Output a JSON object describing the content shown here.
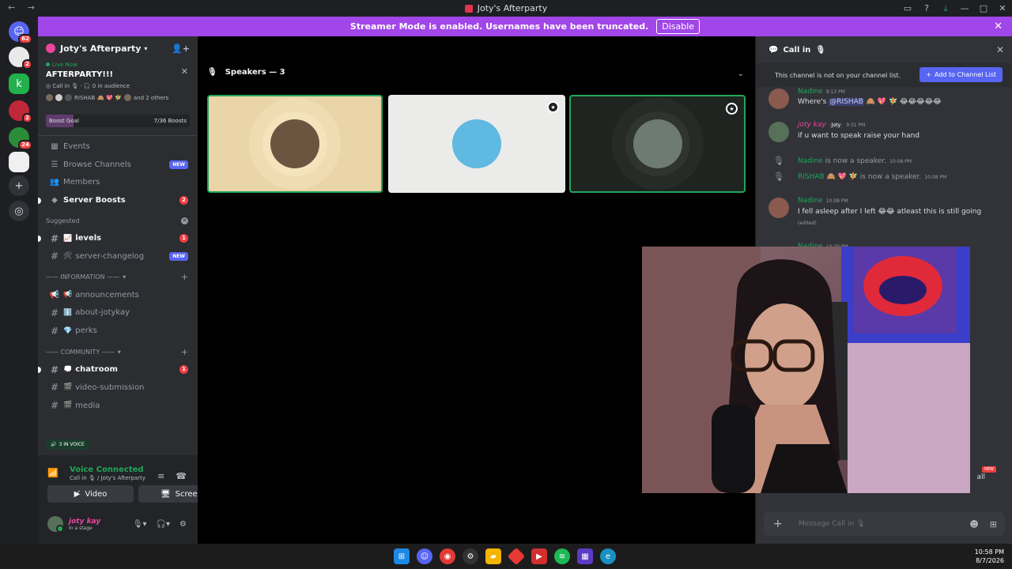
{
  "window": {
    "title": "Joty's Afterparty"
  },
  "guilds": [
    {
      "icon": "discord-home-icon",
      "badge": "62",
      "color": "#5865f2"
    },
    {
      "icon": "server-icon",
      "badge": "2",
      "color": "#e9e9e9"
    },
    {
      "icon": "server-icon",
      "badge": "",
      "color": "#22b14c"
    },
    {
      "icon": "server-icon",
      "badge": "2",
      "color": "#c0283a"
    },
    {
      "icon": "server-icon",
      "badge": "24",
      "color": "#2b8c3a"
    },
    {
      "icon": "server-icon",
      "badge": "",
      "color": "#f0f0f0"
    }
  ],
  "banner": {
    "text": "Streamer Mode is enabled. Usernames have been truncated.",
    "disable_label": "Disable"
  },
  "server": {
    "name": "Joty's Afterparty"
  },
  "live": {
    "status": "Live Now",
    "title": "AFTERPARTY!!!",
    "channel": "Call in",
    "audience": "0 in audience",
    "speaker_name": "RISHAB",
    "others": "and 2 others"
  },
  "boost": {
    "label": "Boost Goal",
    "count": "7/36 Boosts",
    "progress": 0.19
  },
  "nav": {
    "events": "Events",
    "browse": "Browse Channels",
    "browse_badge": "NEW",
    "members": "Members",
    "boosts": "Server Boosts",
    "boosts_badge": "2"
  },
  "suggested": {
    "label": "Suggested",
    "levels": {
      "emoji": "📈",
      "name": "levels",
      "badge": "1"
    },
    "changelog": {
      "emoji": "🛠",
      "name": "server-changelog",
      "badge": "NEW"
    }
  },
  "categories": {
    "information": "—— INFORMATION ——",
    "community": "—— COMMUNITY ——"
  },
  "channels": {
    "announcements": {
      "emoji": "📢",
      "name": "announcements"
    },
    "about": {
      "emoji": "ℹ️",
      "name": "about-jotykay"
    },
    "perks": {
      "emoji": "💎",
      "name": "perks"
    },
    "chatroom": {
      "emoji": "💭",
      "name": "chatroom",
      "badge": "1"
    },
    "video": {
      "emoji": "🎬",
      "name": "video-submission"
    },
    "media": {
      "emoji": "🎬",
      "name": "media"
    }
  },
  "in_voice": "3 IN VOICE",
  "voice": {
    "status": "Voice Connected",
    "location": "Call in 🎙 / Joty's Afterparty",
    "video_label": "Video",
    "screen_label": "Screen"
  },
  "user": {
    "name": "joty kay",
    "status": "In a stage"
  },
  "stage": {
    "speakers_label": "Speakers — 3",
    "tiles": [
      {
        "bg": "#ead5a8",
        "ring1": "#f0dcb2",
        "ring2": "#f5e3bc",
        "pic": "#6b5440",
        "border": "#23a55a",
        "mod": false
      },
      {
        "bg": "#ebebea",
        "ring1": "#ebebea",
        "ring2": "#ebebea",
        "pic": "#5fb9e0",
        "border": "",
        "mod": true
      },
      {
        "bg": "#1f2421",
        "ring1": "#262b28",
        "ring2": "#2f3430",
        "pic": "#6e7a74",
        "border": "#23a55a",
        "mod": true
      }
    ]
  },
  "chat": {
    "title": "Call in",
    "notice": "This channel is not on your channel list.",
    "add_label": "Add to Channel List",
    "messages": [
      {
        "name": "Nadine",
        "time": "9:13 PM",
        "prefix": "Where's ",
        "mention": "@RISHAB",
        "suffix": " 🙈 💖 🧚 😂😂😂😂😂"
      },
      {
        "name": "joty kay",
        "role": "Joty",
        "time": "9:31 PM",
        "text": "if u want to speak raise your hand"
      },
      {
        "name": "Nadine",
        "time": "10:08 PM",
        "text": "is now a speaker."
      },
      {
        "name": "RISHAB 🙈 💖 🧚",
        "time": "10:08 PM",
        "text": "is now a speaker."
      },
      {
        "name": "Nadine",
        "time": "10:08 PM",
        "text": "I fell asleep after I left 😂😂 atleast this is still going",
        "edited": "(edited)"
      },
      {
        "name": "Nadine",
        "time": "10:20 PM"
      }
    ],
    "tail_text": "all",
    "tail_badge": "NEW",
    "input_placeholder": "Message Call in 🎙"
  },
  "taskbar": {
    "time": "10:58 PM",
    "date": "8/7/2026"
  }
}
